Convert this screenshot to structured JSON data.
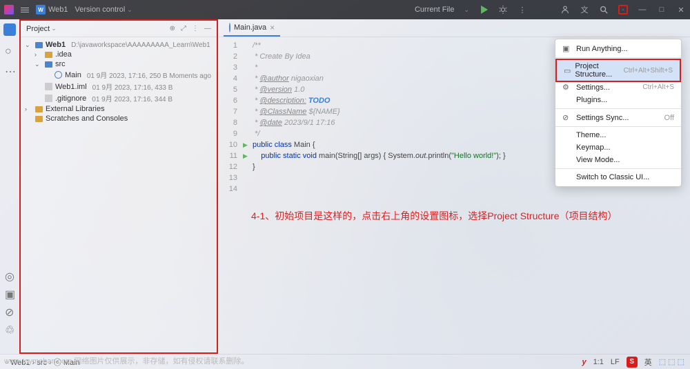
{
  "titlebar": {
    "project_name": "Web1",
    "vcs": "Version control",
    "current_file": "Current File"
  },
  "project_panel": {
    "title": "Project",
    "root": {
      "name": "Web1",
      "path": "D:\\javaworkspace\\AAAAAAAAA_Learn\\Web1"
    },
    "idea_folder": ".idea",
    "src_folder": "src",
    "main_file": {
      "name": "Main",
      "meta": "01 9月 2023, 17:16, 250 B Moments ago"
    },
    "iml_file": {
      "name": "Web1.iml",
      "meta": "01 9月 2023, 17:16, 433 B"
    },
    "gitignore": {
      "name": ".gitignore",
      "meta": "01 9月 2023, 17:16, 344 B"
    },
    "ext_lib": "External Libraries",
    "scratches": "Scratches and Consoles"
  },
  "editor": {
    "tab": "Main.java",
    "lines": {
      "l1": "/**",
      "l2": " * Create By Idea",
      "l3": " *",
      "l4_a": " * ",
      "l4_b": "@author",
      "l4_c": " nigaoxian",
      "l5_a": " * ",
      "l5_b": "@version",
      "l5_c": " 1.0",
      "l6_a": " * ",
      "l6_b": "@description:",
      "l6_c": " TODO",
      "l7_a": " * ",
      "l7_b": "@ClassName",
      "l7_c": " ${NAME}",
      "l8_a": " * ",
      "l8_b": "@date",
      "l8_c": " 2023/9/1 17:16",
      "l9": " */",
      "l10_a": "public class ",
      "l10_b": "Main {",
      "l11_a": "    public static void ",
      "l11_b": "main",
      "l11_c": "(String[] args) { System.",
      "l11_d": "out",
      "l11_e": ".println(",
      "l11_f": "\"Hello world!\"",
      "l11_g": "); }",
      "l12": "}"
    }
  },
  "annotation": "4-1、初始项目是这样的，点击右上角的设置图标，选择Project Structure（项目结构）",
  "menu": {
    "run_anything": "Run Anything...",
    "proj_struct": "Project Structure...",
    "proj_struct_key": "Ctrl+Alt+Shift+S",
    "settings": "Settings...",
    "settings_key": "Ctrl+Alt+S",
    "plugins": "Plugins...",
    "sync": "Settings Sync...",
    "sync_state": "Off",
    "theme": "Theme...",
    "keymap": "Keymap...",
    "viewmode": "View Mode...",
    "classic": "Switch to Classic UI..."
  },
  "statusbar": {
    "breadcrumb_1": "Web1",
    "breadcrumb_2": "src",
    "breadcrumb_3": "Main",
    "pos": "1:1",
    "encoding": "LF",
    "ime": "英"
  },
  "watermark": "www.toymoban.com  网络图片仅供展示，非存储，如有侵权请联系删除。"
}
